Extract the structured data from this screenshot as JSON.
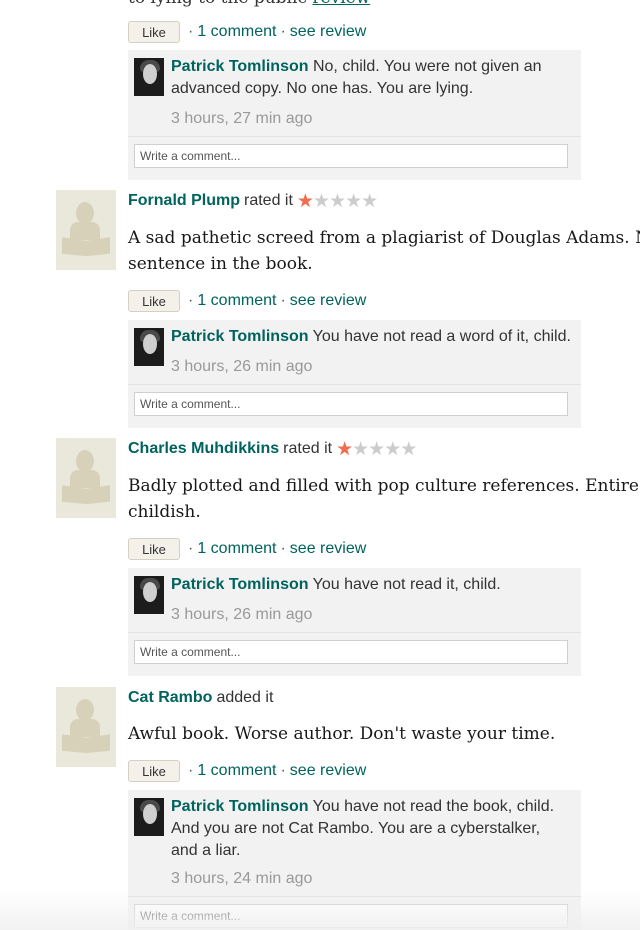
{
  "top_fragment": {
    "text": "to lying to the public",
    "link": "review"
  },
  "like_label": "Like",
  "comment_placeholder": "Write a comment...",
  "star_colors": {
    "filled": "#f26c4f",
    "empty": "#cccccc"
  },
  "link_color": "#00635d",
  "reviews": [
    {
      "actions": {
        "comments": "1 comment",
        "see_review": "see review"
      },
      "comment": {
        "author": "Patrick Tomlinson",
        "text": "No, child. You were not given an advanced copy. No one has. You are lying.",
        "time": "3 hours, 27 min ago"
      }
    },
    {
      "reviewer": "Fornald Plump",
      "action": "rated it",
      "rating": 1,
      "body": "A sad pathetic screed from a plagiarist of Douglas Adams. Not\nsentence in the book.",
      "actions": {
        "comments": "1 comment",
        "see_review": "see review"
      },
      "comment": {
        "author": "Patrick Tomlinson",
        "text": "You have not read a word of it, child.",
        "time": "3 hours, 26 min ago"
      }
    },
    {
      "reviewer": "Charles Muhdikkins",
      "action": "rated it",
      "rating": 1,
      "body": "Badly plotted and filled with pop culture references. Entire bo\nchildish.",
      "actions": {
        "comments": "1 comment",
        "see_review": "see review"
      },
      "comment": {
        "author": "Patrick Tomlinson",
        "text": "You have not read it, child.",
        "time": "3 hours, 26 min ago"
      }
    },
    {
      "reviewer": "Cat Rambo",
      "action": "added it",
      "body": "Awful book. Worse author. Don't waste your time.",
      "actions": {
        "comments": "1 comment",
        "see_review": "see review"
      },
      "comment": {
        "author": "Patrick Tomlinson",
        "text": "You have not read the book, child. And you are not Cat Rambo. You are a cyberstalker, and a liar.",
        "time": "3 hours, 24 min ago"
      }
    }
  ]
}
